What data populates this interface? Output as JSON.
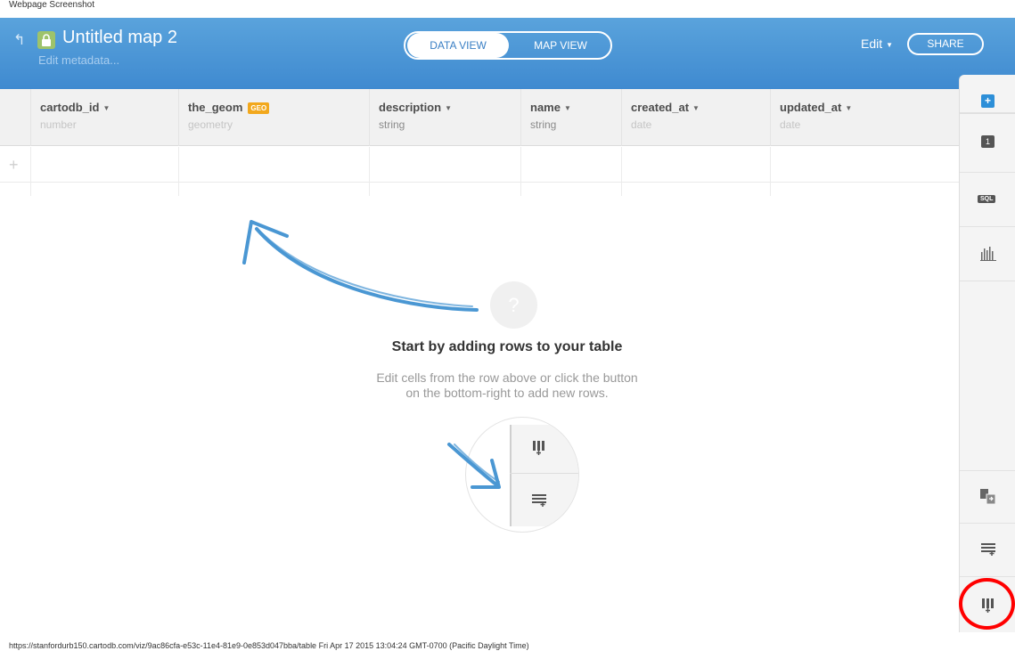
{
  "screenshot_label": "Webpage Screenshot",
  "header": {
    "title": "Untitled map 2",
    "subtitle": "Edit metadata...",
    "views": {
      "data": "DATA VIEW",
      "map": "MAP VIEW"
    },
    "edit_label": "Edit",
    "share_label": "SHARE"
  },
  "table": {
    "columns": [
      {
        "name": "cartodb_id",
        "type": "number"
      },
      {
        "name": "the_geom",
        "type": "geometry",
        "badge": "GEO"
      },
      {
        "name": "description",
        "type": "string"
      },
      {
        "name": "name",
        "type": "string"
      },
      {
        "name": "created_at",
        "type": "date"
      },
      {
        "name": "updated_at",
        "type": "date"
      }
    ],
    "add_row_symbol": "+"
  },
  "empty_state": {
    "help_symbol": "?",
    "title": "Start by adding rows to your table",
    "line1": "Edit cells from the row above or click the button",
    "line2": "on the bottom-right to add new rows."
  },
  "sidebar": {
    "add_symbol": "+",
    "layer_count": "1",
    "sql_label": "SQL",
    "icons": [
      "add-layer-icon",
      "layer-count-icon",
      "sql-icon",
      "chart-icon",
      "merge-tables-icon",
      "add-column-icon",
      "add-row-icon"
    ]
  },
  "colors": {
    "header_blue": "#4796d6",
    "accent_blue": "#2d8fd8",
    "geo_badge": "#f2a81d",
    "highlight": "#ff0000",
    "arrow": "#4a97d3"
  },
  "footer": {
    "url_text": "https://stanfordurb150.cartodb.com/viz/9ac86cfa-e53c-11e4-81e9-0e853d047bba/table Fri Apr 17 2015 13:04:24 GMT-0700 (Pacific Daylight Time)"
  }
}
